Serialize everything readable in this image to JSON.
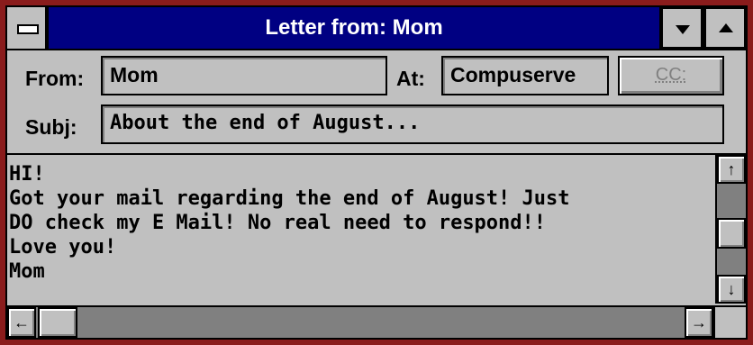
{
  "window": {
    "title": "Letter from: Mom",
    "icons": {
      "system_menu": "system-menu-icon",
      "minimize": "minimize-triangle-icon",
      "maximize": "maximize-triangle-icon"
    }
  },
  "header": {
    "from_label": "From:",
    "from_value": "Mom",
    "at_label": "At:",
    "at_value": "Compuserve",
    "cc_label": "CC:",
    "subj_label": "Subj:",
    "subj_value": "About the end of August..."
  },
  "message": {
    "lines": [
      "HI!",
      "Got your mail regarding the end of August! Just",
      "DO check my E Mail! No real need to respond!!",
      "Love you!",
      "Mom"
    ]
  },
  "scrollbars": {
    "up_arrow": "↑",
    "down_arrow": "↓",
    "left_arrow": "←",
    "right_arrow": "→"
  },
  "colors": {
    "frame": "#8a1c1c",
    "titlebar": "#000082",
    "face": "#c0c0c0"
  }
}
